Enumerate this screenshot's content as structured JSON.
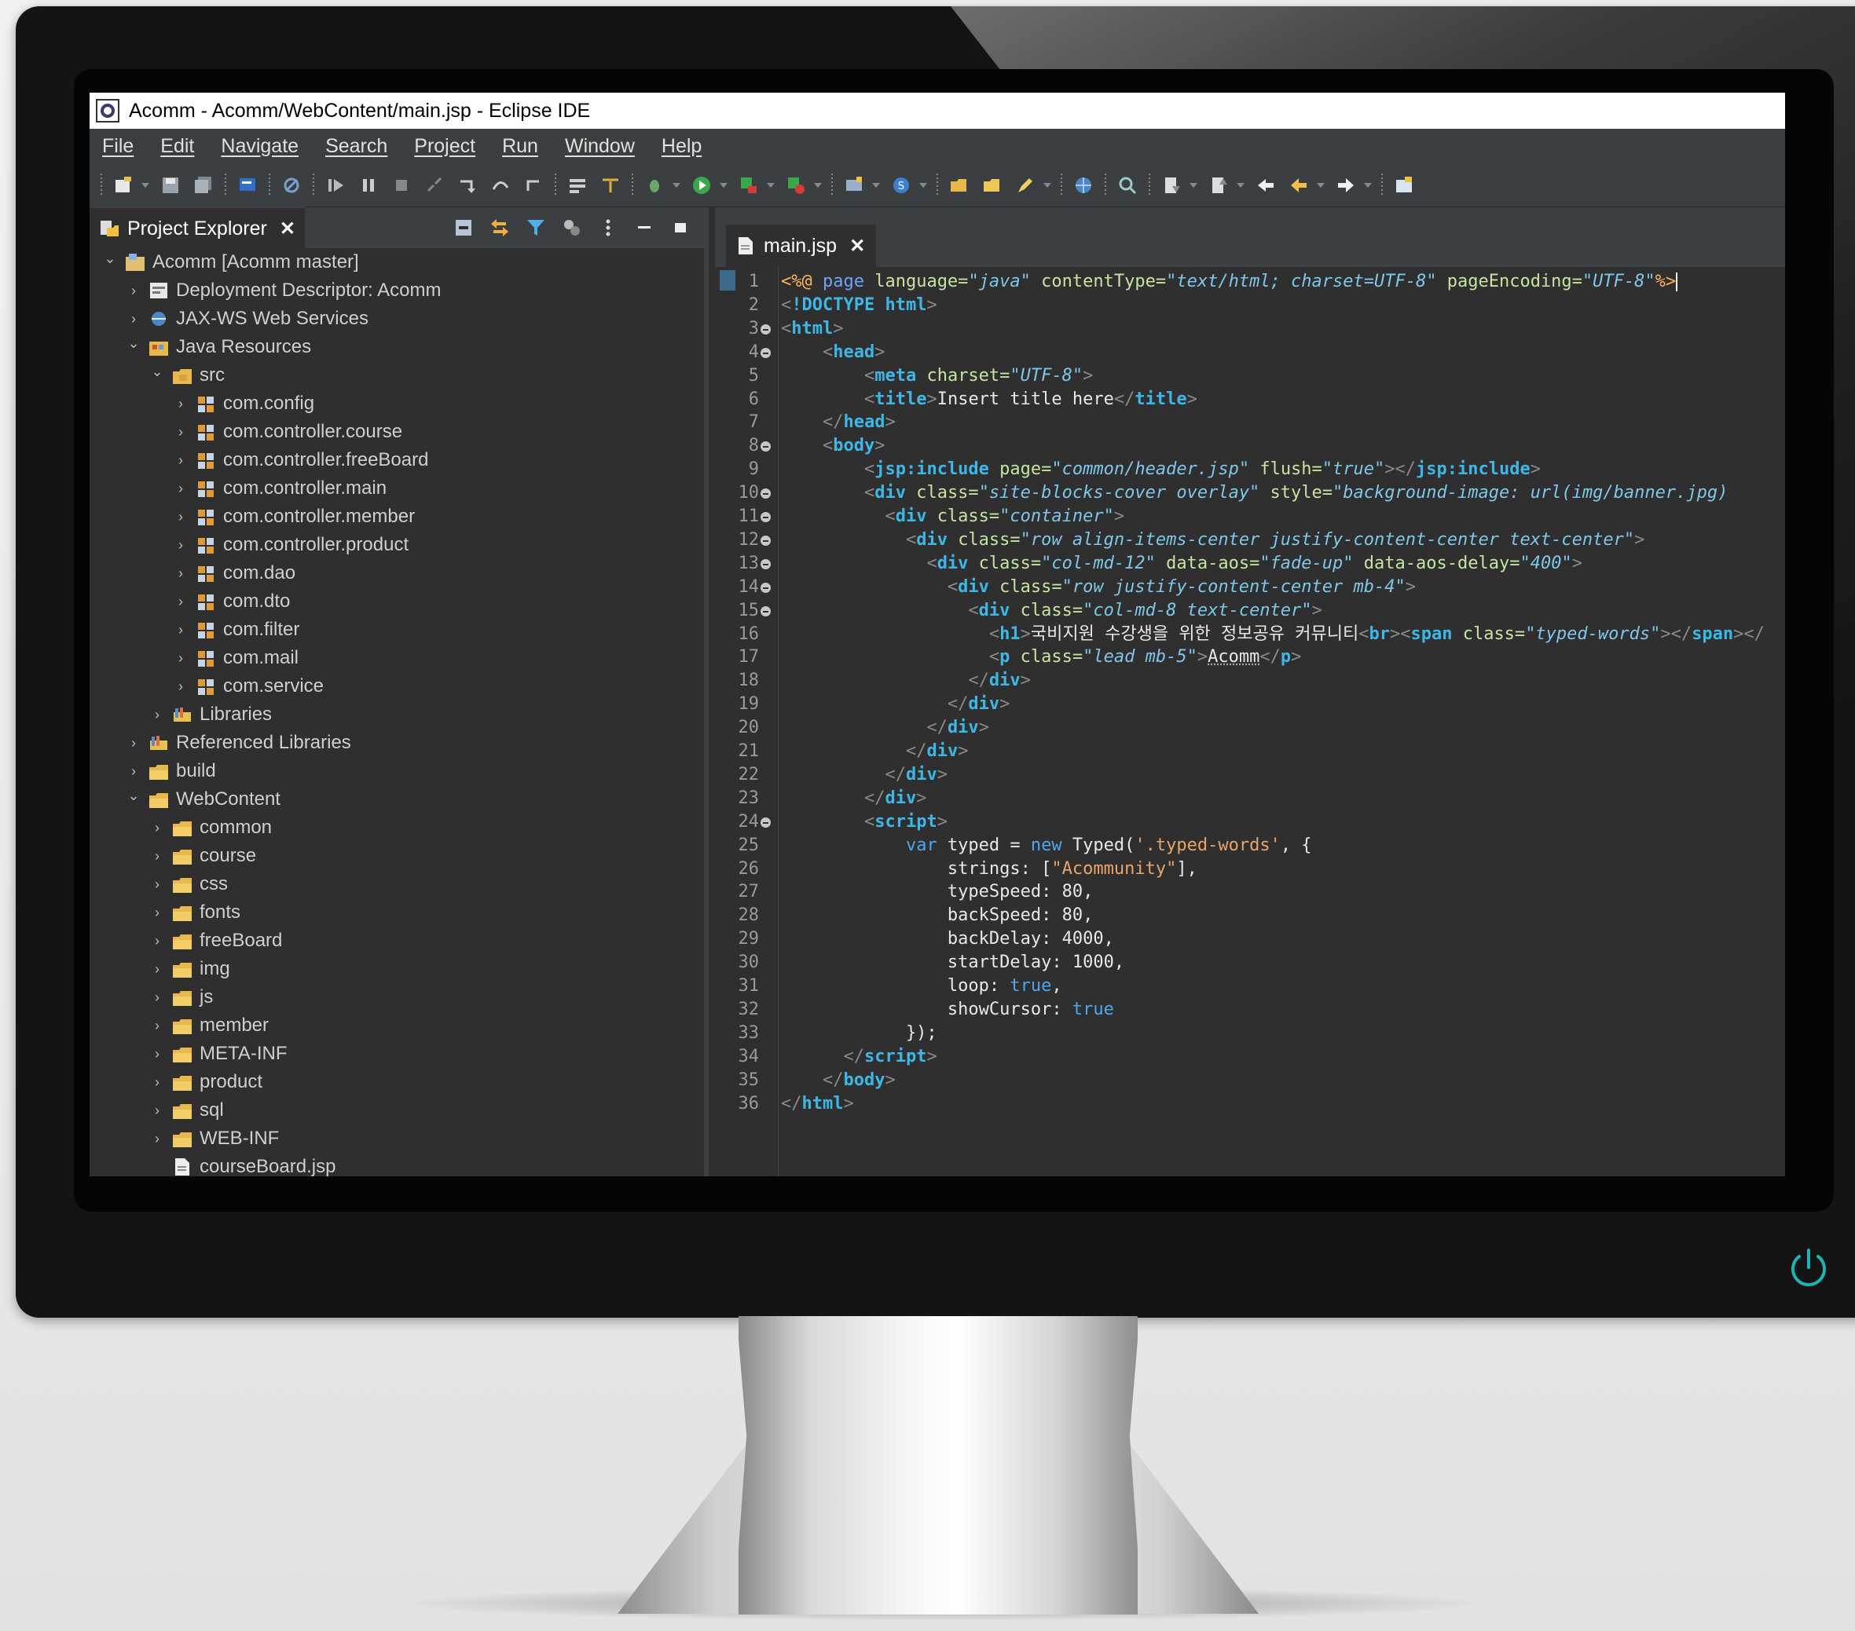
{
  "window": {
    "title": "Acomm - Acomm/WebContent/main.jsp - Eclipse IDE"
  },
  "menu": {
    "items": [
      "File",
      "Edit",
      "Navigate",
      "Search",
      "Project",
      "Run",
      "Window",
      "Help"
    ]
  },
  "explorer": {
    "tab_label": "Project Explorer",
    "tree": [
      {
        "label": "Acomm [Acomm master]",
        "level": 0,
        "expanded": true,
        "icon": "project-icon"
      },
      {
        "label": "Deployment Descriptor: Acomm",
        "level": 1,
        "expanded": false,
        "icon": "descriptor-icon"
      },
      {
        "label": "JAX-WS Web Services",
        "level": 1,
        "expanded": false,
        "icon": "webservice-icon"
      },
      {
        "label": "Java Resources",
        "level": 1,
        "expanded": true,
        "icon": "java-resources-icon"
      },
      {
        "label": "src",
        "level": 2,
        "expanded": true,
        "icon": "src-folder-icon"
      },
      {
        "label": "com.config",
        "level": 3,
        "expanded": false,
        "icon": "package-icon"
      },
      {
        "label": "com.controller.course",
        "level": 3,
        "expanded": false,
        "icon": "package-icon"
      },
      {
        "label": "com.controller.freeBoard",
        "level": 3,
        "expanded": false,
        "icon": "package-icon"
      },
      {
        "label": "com.controller.main",
        "level": 3,
        "expanded": false,
        "icon": "package-icon"
      },
      {
        "label": "com.controller.member",
        "level": 3,
        "expanded": false,
        "icon": "package-icon"
      },
      {
        "label": "com.controller.product",
        "level": 3,
        "expanded": false,
        "icon": "package-icon"
      },
      {
        "label": "com.dao",
        "level": 3,
        "expanded": false,
        "icon": "package-icon"
      },
      {
        "label": "com.dto",
        "level": 3,
        "expanded": false,
        "icon": "package-icon"
      },
      {
        "label": "com.filter",
        "level": 3,
        "expanded": false,
        "icon": "package-icon"
      },
      {
        "label": "com.mail",
        "level": 3,
        "expanded": false,
        "icon": "package-icon"
      },
      {
        "label": "com.service",
        "level": 3,
        "expanded": false,
        "icon": "package-icon"
      },
      {
        "label": "Libraries",
        "level": 2,
        "expanded": false,
        "icon": "library-icon"
      },
      {
        "label": "Referenced Libraries",
        "level": 1,
        "expanded": false,
        "icon": "library-icon"
      },
      {
        "label": "build",
        "level": 1,
        "expanded": false,
        "icon": "folder-icon"
      },
      {
        "label": "WebContent",
        "level": 1,
        "expanded": true,
        "icon": "folder-icon"
      },
      {
        "label": "common",
        "level": 2,
        "expanded": false,
        "icon": "folder-icon"
      },
      {
        "label": "course",
        "level": 2,
        "expanded": false,
        "icon": "folder-icon"
      },
      {
        "label": "css",
        "level": 2,
        "expanded": false,
        "icon": "folder-icon"
      },
      {
        "label": "fonts",
        "level": 2,
        "expanded": false,
        "icon": "folder-icon"
      },
      {
        "label": "freeBoard",
        "level": 2,
        "expanded": false,
        "icon": "folder-icon"
      },
      {
        "label": "img",
        "level": 2,
        "expanded": false,
        "icon": "folder-icon"
      },
      {
        "label": "js",
        "level": 2,
        "expanded": false,
        "icon": "folder-icon"
      },
      {
        "label": "member",
        "level": 2,
        "expanded": false,
        "icon": "folder-icon"
      },
      {
        "label": "META-INF",
        "level": 2,
        "expanded": false,
        "icon": "folder-icon"
      },
      {
        "label": "product",
        "level": 2,
        "expanded": false,
        "icon": "folder-icon"
      },
      {
        "label": "sql",
        "level": 2,
        "expanded": false,
        "icon": "folder-icon"
      },
      {
        "label": "WEB-INF",
        "level": 2,
        "expanded": false,
        "icon": "folder-icon"
      },
      {
        "label": "courseBoard.jsp",
        "level": 2,
        "expanded": null,
        "icon": "jsp-file-icon"
      }
    ]
  },
  "editor": {
    "tab_label": "main.jsp",
    "lines": [
      {
        "n": "1",
        "fold": false,
        "tokens": [
          [
            "dir",
            "<%@ "
          ],
          [
            "kw",
            "page "
          ],
          [
            "attr",
            "language="
          ],
          [
            "str",
            "\"java\""
          ],
          [
            "attr",
            " contentType="
          ],
          [
            "str",
            "\"text/html; charset=UTF-8\""
          ],
          [
            "attr",
            " pageEncoding="
          ],
          [
            "str",
            "\"UTF-8\""
          ],
          [
            "dir",
            "%>"
          ]
        ]
      },
      {
        "n": "2",
        "fold": false,
        "tokens": [
          [
            "bracket",
            "<"
          ],
          [
            "tag",
            "!DOCTYPE html"
          ],
          [
            "bracket",
            ">"
          ]
        ]
      },
      {
        "n": "3",
        "fold": true,
        "tokens": [
          [
            "bracket",
            "<"
          ],
          [
            "tag",
            "html"
          ],
          [
            "bracket",
            ">"
          ]
        ]
      },
      {
        "n": "4",
        "fold": true,
        "tokens": [
          [
            "text",
            "    "
          ],
          [
            "bracket",
            "<"
          ],
          [
            "tag",
            "head"
          ],
          [
            "bracket",
            ">"
          ]
        ]
      },
      {
        "n": "5",
        "fold": false,
        "tokens": [
          [
            "text",
            "        "
          ],
          [
            "bracket",
            "<"
          ],
          [
            "tag",
            "meta "
          ],
          [
            "attr",
            "charset="
          ],
          [
            "str",
            "\"UTF-8\""
          ],
          [
            "bracket",
            ">"
          ]
        ]
      },
      {
        "n": "6",
        "fold": false,
        "tokens": [
          [
            "text",
            "        "
          ],
          [
            "bracket",
            "<"
          ],
          [
            "tag",
            "title"
          ],
          [
            "bracket",
            ">"
          ],
          [
            "text",
            "Insert title here"
          ],
          [
            "bracket",
            "</"
          ],
          [
            "tag",
            "title"
          ],
          [
            "bracket",
            ">"
          ]
        ]
      },
      {
        "n": "7",
        "fold": false,
        "tokens": [
          [
            "text",
            "    "
          ],
          [
            "bracket",
            "</"
          ],
          [
            "tag",
            "head"
          ],
          [
            "bracket",
            ">"
          ]
        ]
      },
      {
        "n": "8",
        "fold": true,
        "tokens": [
          [
            "text",
            "    "
          ],
          [
            "bracket",
            "<"
          ],
          [
            "tag",
            "body"
          ],
          [
            "bracket",
            ">"
          ]
        ]
      },
      {
        "n": "9",
        "fold": false,
        "tokens": [
          [
            "text",
            "        "
          ],
          [
            "bracket",
            "<"
          ],
          [
            "tag",
            "jsp:include "
          ],
          [
            "attr",
            "page="
          ],
          [
            "str",
            "\"common/header.jsp\""
          ],
          [
            "attr",
            " flush="
          ],
          [
            "str",
            "\"true\""
          ],
          [
            "bracket",
            "></"
          ],
          [
            "tag",
            "jsp:include"
          ],
          [
            "bracket",
            ">"
          ]
        ]
      },
      {
        "n": "10",
        "fold": true,
        "tokens": [
          [
            "text",
            "        "
          ],
          [
            "bracket",
            "<"
          ],
          [
            "tag",
            "div "
          ],
          [
            "attr",
            "class="
          ],
          [
            "str",
            "\"site-blocks-cover overlay\""
          ],
          [
            "attr",
            " style="
          ],
          [
            "str",
            "\"background-image: url(img/banner.jpg)"
          ]
        ]
      },
      {
        "n": "11",
        "fold": true,
        "tokens": [
          [
            "text",
            "          "
          ],
          [
            "bracket",
            "<"
          ],
          [
            "tag",
            "div "
          ],
          [
            "attr",
            "class="
          ],
          [
            "str",
            "\"container\""
          ],
          [
            "bracket",
            ">"
          ]
        ]
      },
      {
        "n": "12",
        "fold": true,
        "tokens": [
          [
            "text",
            "            "
          ],
          [
            "bracket",
            "<"
          ],
          [
            "tag",
            "div "
          ],
          [
            "attr",
            "class="
          ],
          [
            "str",
            "\"row align-items-center justify-content-center text-center\""
          ],
          [
            "bracket",
            ">"
          ]
        ]
      },
      {
        "n": "13",
        "fold": true,
        "tokens": [
          [
            "text",
            "              "
          ],
          [
            "bracket",
            "<"
          ],
          [
            "tag",
            "div "
          ],
          [
            "attr",
            "class="
          ],
          [
            "str",
            "\"col-md-12\""
          ],
          [
            "attr",
            " data-aos="
          ],
          [
            "str",
            "\"fade-up\""
          ],
          [
            "attr",
            " data-aos-delay="
          ],
          [
            "str",
            "\"400\""
          ],
          [
            "bracket",
            ">"
          ]
        ]
      },
      {
        "n": "14",
        "fold": true,
        "tokens": [
          [
            "text",
            "                "
          ],
          [
            "bracket",
            "<"
          ],
          [
            "tag",
            "div "
          ],
          [
            "attr",
            "class="
          ],
          [
            "str",
            "\"row justify-content-center mb-4\""
          ],
          [
            "bracket",
            ">"
          ]
        ]
      },
      {
        "n": "15",
        "fold": true,
        "tokens": [
          [
            "text",
            "                  "
          ],
          [
            "bracket",
            "<"
          ],
          [
            "tag",
            "div "
          ],
          [
            "attr",
            "class="
          ],
          [
            "str",
            "\"col-md-8 text-center\""
          ],
          [
            "bracket",
            ">"
          ]
        ]
      },
      {
        "n": "16",
        "fold": false,
        "tokens": [
          [
            "text",
            "                    "
          ],
          [
            "bracket",
            "<"
          ],
          [
            "tag",
            "h1"
          ],
          [
            "bracket",
            ">"
          ],
          [
            "text",
            "국비지원 수강생을 위한 정보공유 커뮤니티"
          ],
          [
            "bracket",
            "<"
          ],
          [
            "tag",
            "br"
          ],
          [
            "bracket",
            "><"
          ],
          [
            "tag",
            "span "
          ],
          [
            "attr",
            "class="
          ],
          [
            "str",
            "\"typed-words\""
          ],
          [
            "bracket",
            "></"
          ],
          [
            "tag",
            "span"
          ],
          [
            "bracket",
            "></"
          ]
        ]
      },
      {
        "n": "17",
        "fold": false,
        "tokens": [
          [
            "text",
            "                    "
          ],
          [
            "bracket",
            "<"
          ],
          [
            "tag",
            "p "
          ],
          [
            "attr",
            "class="
          ],
          [
            "str",
            "\"lead mb-5\""
          ],
          [
            "bracket",
            ">"
          ],
          [
            "link",
            "Acomm"
          ],
          [
            "bracket",
            "</"
          ],
          [
            "tag",
            "p"
          ],
          [
            "bracket",
            ">"
          ]
        ]
      },
      {
        "n": "18",
        "fold": false,
        "tokens": [
          [
            "text",
            "                  "
          ],
          [
            "bracket",
            "</"
          ],
          [
            "tag",
            "div"
          ],
          [
            "bracket",
            ">"
          ]
        ]
      },
      {
        "n": "19",
        "fold": false,
        "tokens": [
          [
            "text",
            "                "
          ],
          [
            "bracket",
            "</"
          ],
          [
            "tag",
            "div"
          ],
          [
            "bracket",
            ">"
          ]
        ]
      },
      {
        "n": "20",
        "fold": false,
        "tokens": [
          [
            "text",
            "              "
          ],
          [
            "bracket",
            "</"
          ],
          [
            "tag",
            "div"
          ],
          [
            "bracket",
            ">"
          ]
        ]
      },
      {
        "n": "21",
        "fold": false,
        "tokens": [
          [
            "text",
            "            "
          ],
          [
            "bracket",
            "</"
          ],
          [
            "tag",
            "div"
          ],
          [
            "bracket",
            ">"
          ]
        ]
      },
      {
        "n": "22",
        "fold": false,
        "tokens": [
          [
            "text",
            "          "
          ],
          [
            "bracket",
            "</"
          ],
          [
            "tag",
            "div"
          ],
          [
            "bracket",
            ">"
          ]
        ]
      },
      {
        "n": "23",
        "fold": false,
        "tokens": [
          [
            "text",
            "        "
          ],
          [
            "bracket",
            "</"
          ],
          [
            "tag",
            "div"
          ],
          [
            "bracket",
            ">"
          ]
        ]
      },
      {
        "n": "24",
        "fold": true,
        "tokens": [
          [
            "text",
            "        "
          ],
          [
            "bracket",
            "<"
          ],
          [
            "tag",
            "script"
          ],
          [
            "bracket",
            ">"
          ]
        ]
      },
      {
        "n": "25",
        "fold": false,
        "tokens": [
          [
            "js",
            "            "
          ],
          [
            "jkw",
            "var "
          ],
          [
            "js",
            "typed = "
          ],
          [
            "jkw",
            "new "
          ],
          [
            "js",
            "Typed("
          ],
          [
            "jstr",
            "'.typed-words'"
          ],
          [
            "js",
            ", {"
          ]
        ]
      },
      {
        "n": "26",
        "fold": false,
        "tokens": [
          [
            "js",
            "                strings: ["
          ],
          [
            "jstr",
            "\"Acommunity\""
          ],
          [
            "js",
            "],"
          ]
        ]
      },
      {
        "n": "27",
        "fold": false,
        "tokens": [
          [
            "js",
            "                typeSpeed: 80,"
          ]
        ]
      },
      {
        "n": "28",
        "fold": false,
        "tokens": [
          [
            "js",
            "                backSpeed: 80,"
          ]
        ]
      },
      {
        "n": "29",
        "fold": false,
        "tokens": [
          [
            "js",
            "                backDelay: 4000,"
          ]
        ]
      },
      {
        "n": "30",
        "fold": false,
        "tokens": [
          [
            "js",
            "                startDelay: 1000,"
          ]
        ]
      },
      {
        "n": "31",
        "fold": false,
        "tokens": [
          [
            "js",
            "                loop: "
          ],
          [
            "jkw",
            "true"
          ],
          [
            "js",
            ","
          ]
        ]
      },
      {
        "n": "32",
        "fold": false,
        "tokens": [
          [
            "js",
            "                showCursor: "
          ],
          [
            "jkw",
            "true"
          ]
        ]
      },
      {
        "n": "33",
        "fold": false,
        "tokens": [
          [
            "js",
            "            });"
          ]
        ]
      },
      {
        "n": "34",
        "fold": false,
        "tokens": [
          [
            "text",
            "      "
          ],
          [
            "bracket",
            "</"
          ],
          [
            "tag",
            "script"
          ],
          [
            "bracket",
            ">"
          ]
        ]
      },
      {
        "n": "35",
        "fold": false,
        "tokens": [
          [
            "text",
            "    "
          ],
          [
            "bracket",
            "</"
          ],
          [
            "tag",
            "body"
          ],
          [
            "bracket",
            ">"
          ]
        ]
      },
      {
        "n": "36",
        "fold": false,
        "tokens": [
          [
            "bracket",
            "</"
          ],
          [
            "tag",
            "html"
          ],
          [
            "bracket",
            ">"
          ]
        ]
      }
    ]
  },
  "colors": {
    "accent_power": "#1fb3b3",
    "ide_background": "#2f2f2f",
    "toolbar_background": "#3c3f41"
  }
}
